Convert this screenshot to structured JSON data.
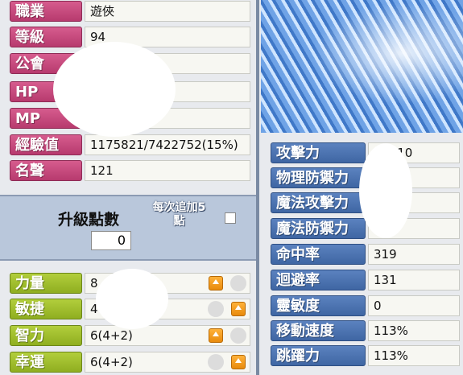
{
  "info": [
    {
      "label": "職業",
      "value": "遊俠"
    },
    {
      "label": "等級",
      "value": "94"
    },
    {
      "label": "公會",
      "value": ""
    },
    {
      "label": "HP",
      "value": ""
    },
    {
      "label": "MP",
      "value": ""
    },
    {
      "label": "經驗值",
      "value": "1175821/7422752(15%)"
    },
    {
      "label": "名聲",
      "value": "121"
    }
  ],
  "levelup": {
    "title": "升級點數",
    "points": "0",
    "per_add_label": "每次追加5",
    "per_add_unit": "點"
  },
  "stats": [
    {
      "label": "力量",
      "value": "8"
    },
    {
      "label": "敏捷",
      "value": "4"
    },
    {
      "label": "智力",
      "value": "6(4+2)"
    },
    {
      "label": "幸運",
      "value": "6(4+2)"
    }
  ],
  "combat": [
    {
      "label": "攻擊力",
      "value": "- 1710"
    },
    {
      "label": "物理防禦力",
      "value": ""
    },
    {
      "label": "魔法攻擊力",
      "value": ""
    },
    {
      "label": "魔法防禦力",
      "value": ""
    },
    {
      "label": "命中率",
      "value": "319"
    },
    {
      "label": "迴避率",
      "value": "131"
    },
    {
      "label": "靈敏度",
      "value": "0"
    },
    {
      "label": "移動速度",
      "value": "113%"
    },
    {
      "label": "跳躍力",
      "value": "113%"
    }
  ]
}
